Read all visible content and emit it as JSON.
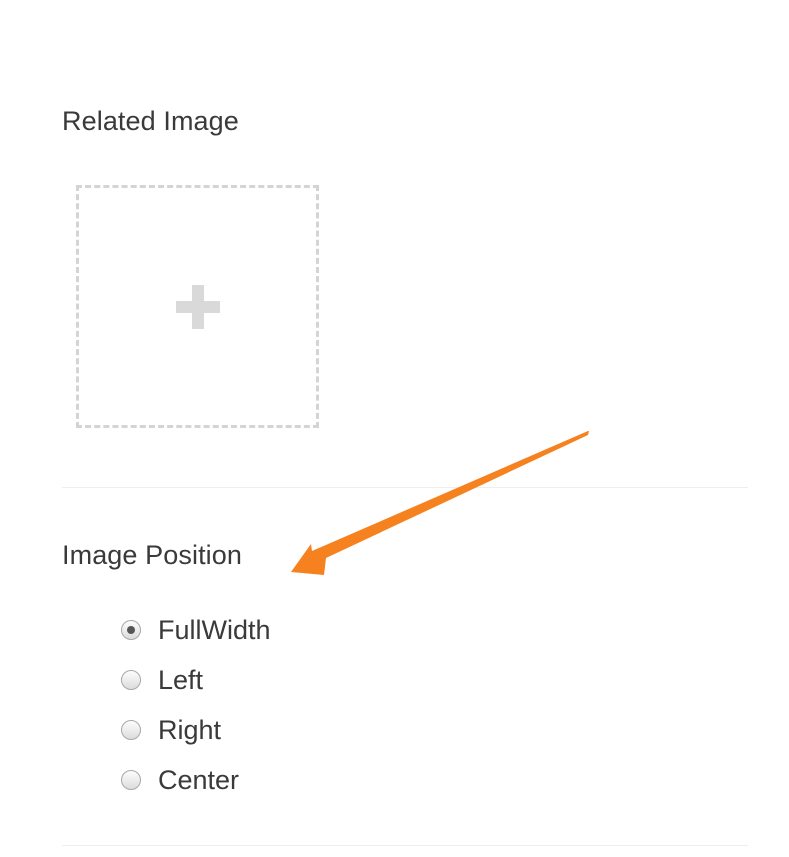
{
  "related_image": {
    "label": "Related Image",
    "add_icon": "plus-icon"
  },
  "image_position": {
    "label": "Image Position",
    "selected": "FullWidth",
    "options": [
      {
        "label": "FullWidth",
        "checked": true
      },
      {
        "label": "Left",
        "checked": false
      },
      {
        "label": "Right",
        "checked": false
      },
      {
        "label": "Center",
        "checked": false
      }
    ]
  },
  "annotation": {
    "arrow_color": "#F5821F"
  }
}
